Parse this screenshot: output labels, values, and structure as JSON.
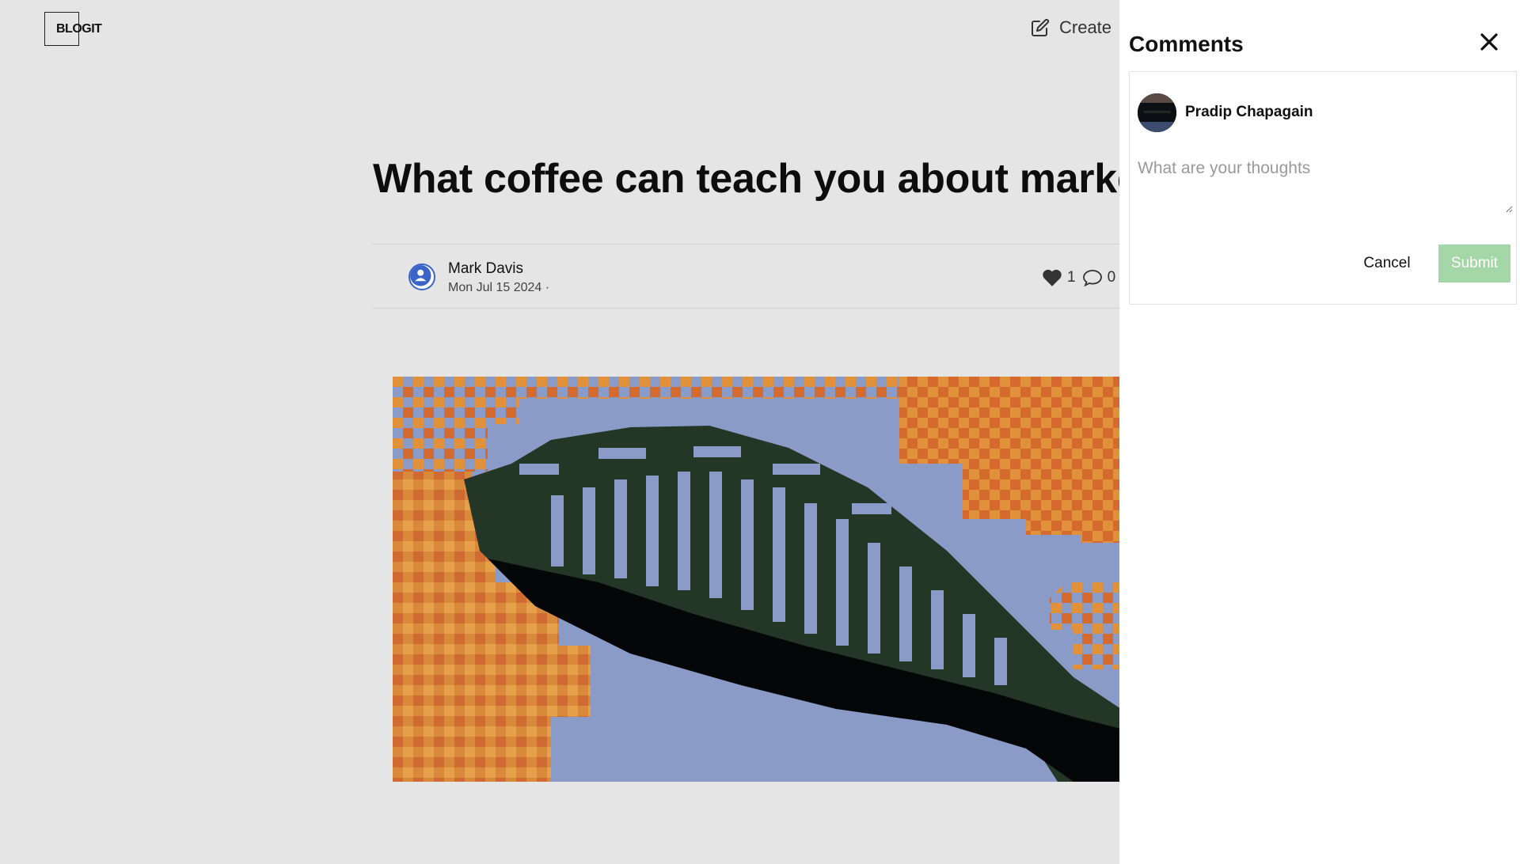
{
  "header": {
    "logo_text": "BLOGIT",
    "create_label": "Create"
  },
  "article": {
    "title": "What coffee can teach you about marketing",
    "author": "Mark Davis",
    "date": "Mon Jul 15 2024 ·",
    "likes": "1",
    "comments": "0",
    "hero_image_icon": "bridge-illustration"
  },
  "comments_panel": {
    "title": "Comments",
    "current_user": "Pradip Chapagain",
    "input_placeholder": "What are your thoughts",
    "cancel_label": "Cancel",
    "submit_label": "Submit",
    "submit_color": "#a5d6a7"
  },
  "colors": {
    "page_background": "#e5e5e5",
    "panel_background": "#ffffff"
  }
}
